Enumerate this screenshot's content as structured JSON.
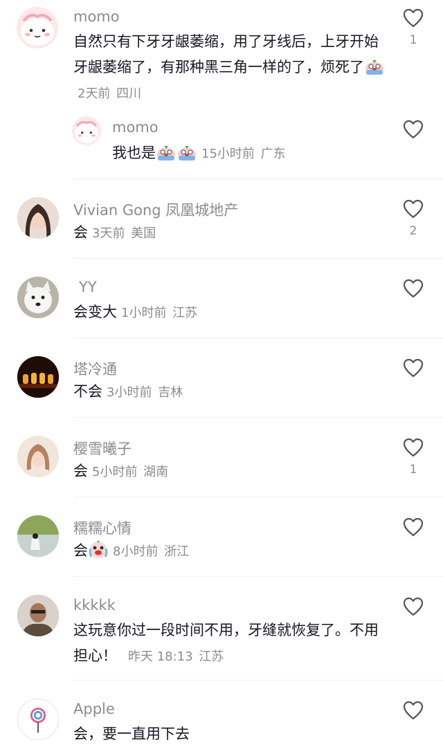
{
  "comments": [
    {
      "user": "momo",
      "text": "自然只有下牙牙龈萎缩，用了牙线后，上牙开始牙龈萎缩了，有那种黑三角一样的了，烦死了",
      "time": "2天前",
      "location": "四川",
      "likes": "1"
    },
    {
      "user": "momo",
      "text": "我也是",
      "time": "15小时前",
      "location": "广东",
      "likes": ""
    },
    {
      "user": "Vivian Gong 凤凰城地产",
      "text": "会",
      "time": "3天前",
      "location": "美国",
      "likes": "2"
    },
    {
      "user": "YY",
      "text": "会变大",
      "time": "1小时前",
      "location": "江苏",
      "likes": ""
    },
    {
      "user": "塔冷通",
      "text": "不会",
      "time": "3小时前",
      "location": "吉林",
      "likes": ""
    },
    {
      "user": "樱雪曦子",
      "text": "会",
      "time": "5小时前",
      "location": "湖南",
      "likes": "1"
    },
    {
      "user": "糯糯心情",
      "text": "会",
      "time": "8小时前",
      "location": "浙江",
      "likes": ""
    },
    {
      "user": "kkkkk",
      "text": "这玩意你过一段时间不用，牙缝就恢复了。不用担心！",
      "time": "昨天 18:13",
      "location": "江苏",
      "likes": ""
    },
    {
      "user": "Apple",
      "text": "会，要一直用下去",
      "time": "",
      "location": "",
      "likes": ""
    }
  ]
}
